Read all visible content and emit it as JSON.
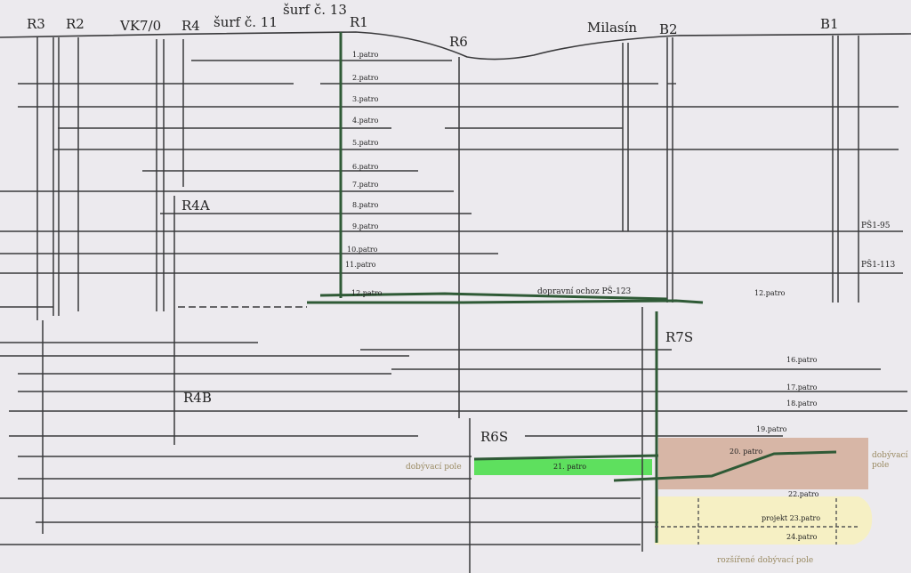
{
  "shafts": {
    "r3": "R3",
    "r2": "R2",
    "vk7": "VK7/0",
    "r4": "R4",
    "surf11": "šurf č. 11",
    "surf13": "šurf č. 13",
    "r1": "R1",
    "r6": "R6",
    "milasin": "Milasín",
    "b2": "B2",
    "b1": "B1",
    "r4a": "R4A",
    "r4b": "R4B",
    "r6s": "R6S",
    "r7s": "R7S"
  },
  "levels": [
    "1.patro",
    "2.patro",
    "3.patro",
    "4.patro",
    "5.patro",
    "6.patro",
    "7.patro",
    "8.patro",
    "9.patro",
    "10.patro",
    "11.patro",
    "12.patro"
  ],
  "right_levels": {
    "l12": "12.patro",
    "l16": "16.patro",
    "l17": "17.patro",
    "l18": "18.patro",
    "l19": "19.patro",
    "l20": "20. patro",
    "l21": "21. patro",
    "l22": "22.patro",
    "l23": "projekt 23.patro",
    "l24": "24.patro"
  },
  "side": {
    "ps195": "PŠ1-95",
    "ps1113": "PŠ1-113",
    "transport": "dopravní ochoz PŠ-123"
  },
  "zones": {
    "mining_left": "dobývací pole",
    "mining_right": "dobývací\npole",
    "extended": "rozšířené dobývací pole"
  },
  "colors": {
    "background": "#eceaee",
    "line": "#3a3a3c",
    "shaft_green": "#2f5a36",
    "mining_green": "#5ee05e",
    "mining_brown": "#d7b6a6",
    "extended_yellow": "#f6f0c4",
    "zone_text": "#9a8a62"
  }
}
